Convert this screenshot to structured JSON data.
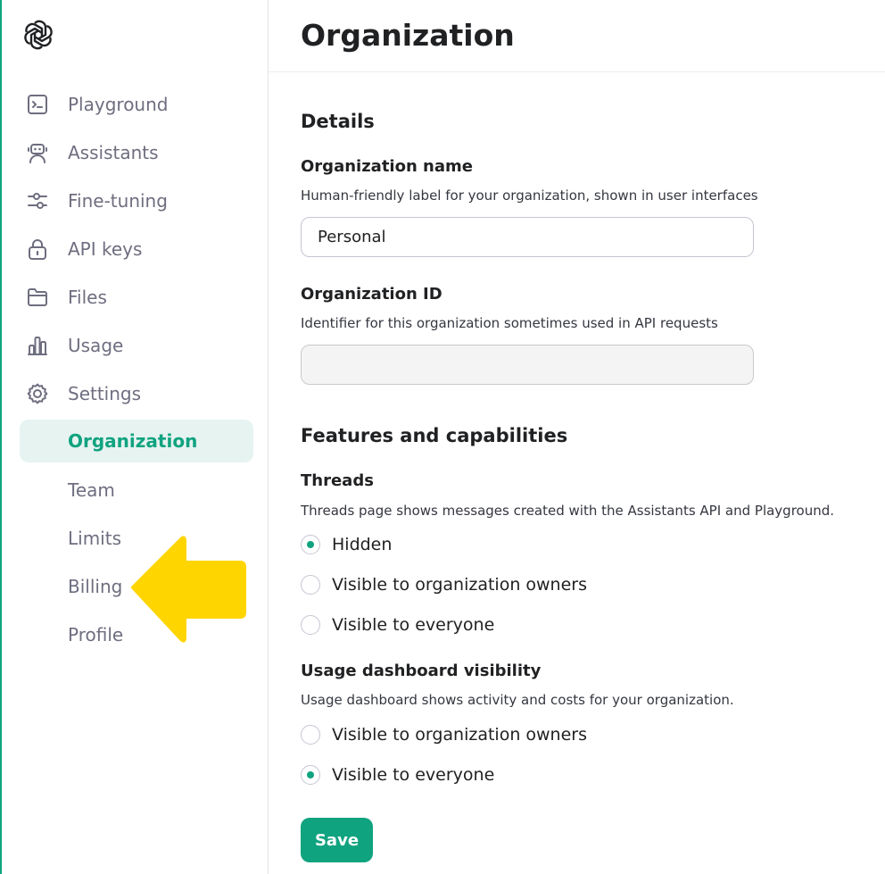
{
  "app": {
    "name": "OpenAI",
    "accent_color": "#10a37f",
    "logo_icon": "openai-logo-icon"
  },
  "sidebar": {
    "items": [
      {
        "label": "Playground",
        "icon": "terminal-icon"
      },
      {
        "label": "Assistants",
        "icon": "robot-icon"
      },
      {
        "label": "Fine-tuning",
        "icon": "sliders-icon"
      },
      {
        "label": "API keys",
        "icon": "lock-icon"
      },
      {
        "label": "Files",
        "icon": "folder-icon"
      },
      {
        "label": "Usage",
        "icon": "bar-chart-icon"
      },
      {
        "label": "Settings",
        "icon": "gear-icon"
      }
    ],
    "settings_items": [
      {
        "label": "Organization",
        "active": true
      },
      {
        "label": "Team"
      },
      {
        "label": "Limits"
      },
      {
        "label": "Billing"
      },
      {
        "label": "Profile"
      }
    ],
    "annotation": {
      "icon": "pointer-arrow-icon",
      "color": "#ffd500"
    }
  },
  "page": {
    "title": "Organization"
  },
  "details": {
    "heading": "Details",
    "org_name": {
      "label": "Organization name",
      "description": "Human-friendly label for your organization, shown in user interfaces",
      "value": "Personal"
    },
    "org_id": {
      "label": "Organization ID",
      "description": "Identifier for this organization sometimes used in API requests",
      "value": ""
    }
  },
  "features": {
    "heading": "Features and capabilities",
    "threads": {
      "label": "Threads",
      "description": "Threads page shows messages created with the Assistants API and Playground.",
      "options": [
        "Hidden",
        "Visible to organization owners",
        "Visible to everyone"
      ],
      "selected": "Hidden"
    },
    "usage_dashboard": {
      "label": "Usage dashboard visibility",
      "description": "Usage dashboard shows activity and costs for your organization.",
      "options": [
        "Visible to organization owners",
        "Visible to everyone"
      ],
      "selected": "Visible to everyone"
    }
  },
  "actions": {
    "save_label": "Save"
  }
}
